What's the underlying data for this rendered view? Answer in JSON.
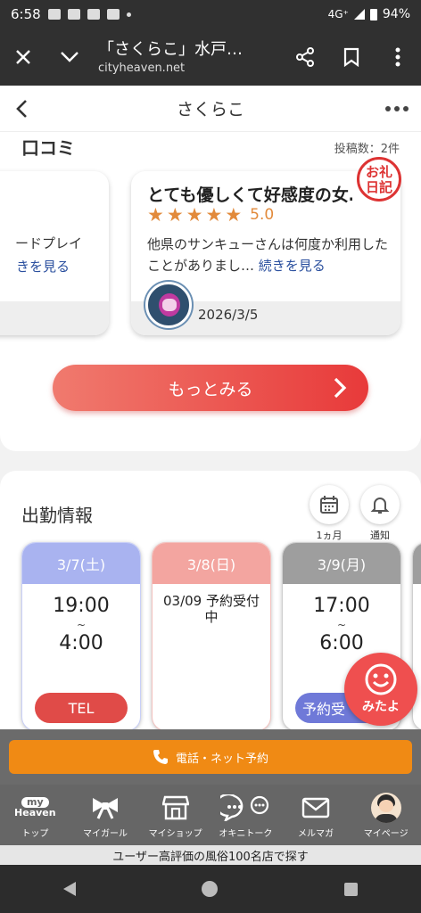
{
  "status_bar": {
    "time": "6:58",
    "network": "4G⁺",
    "battery": "94%"
  },
  "browser": {
    "tab_title": "「さくらこ」水戸…",
    "url": "cityheaven.net"
  },
  "page": {
    "title": "さくらこ"
  },
  "reviews": {
    "section_title": "口コミ",
    "post_count": "投稿数：2件",
    "left_card": {
      "snippet": "ードプレイ",
      "link": "きを見る"
    },
    "main_card": {
      "title": "とても優しくて好感度の女…",
      "stars": 5,
      "score": "5.0",
      "body": "他県のサンキューさんは何度か利用したことがありまし…",
      "read_more": "続きを見る",
      "date": "2026/3/5"
    },
    "stamp_text": "お礼日記",
    "more_button": "もっとみる"
  },
  "attendance": {
    "section_title": "出勤情報",
    "month_label": "1ヵ月",
    "notify_label": "通知",
    "days": [
      {
        "date": "3/7(土)",
        "start": "19:00",
        "tilde": "~",
        "end": "4:00",
        "button": "TEL"
      },
      {
        "date": "3/8(日)",
        "note": "03/09 予約受付中"
      },
      {
        "date": "3/9(月)",
        "start": "17:00",
        "tilde": "~",
        "end": "6:00",
        "button": "予約受"
      }
    ],
    "mitayo_label": "みたよ"
  },
  "reserve": {
    "button": "電話・ネット予約"
  },
  "bottom_nav": {
    "logo_top": "my",
    "logo_bottom": "Heaven",
    "items": [
      "トップ",
      "マイガール",
      "マイショップ",
      "オキニトーク",
      "メルマガ",
      "マイページ"
    ]
  },
  "banner": "ユーザー高評価の風俗100名店で探す",
  "colors": {
    "accent_red": "#e83a3a",
    "orange": "#f08a14",
    "blue_header": "#a9b3f0",
    "pink_header": "#f3a5a0",
    "gray_header": "#9e9e9e"
  }
}
